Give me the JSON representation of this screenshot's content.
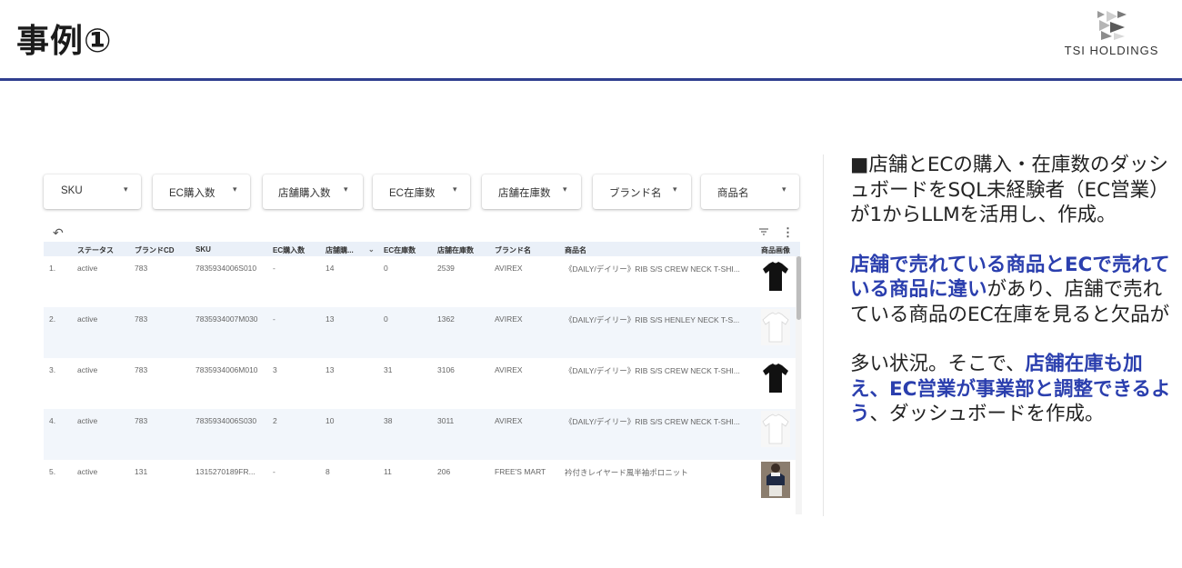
{
  "slide": {
    "title": "事例①",
    "logo_text": "TSI HOLDINGS"
  },
  "filters": [
    {
      "label": "SKU"
    },
    {
      "label": "EC購入数"
    },
    {
      "label": "店舗購入数"
    },
    {
      "label": "EC在庫数"
    },
    {
      "label": "店舗在庫数"
    },
    {
      "label": "ブランド名"
    },
    {
      "label": "商品名"
    }
  ],
  "table": {
    "headers": [
      "ステータス",
      "ブランドCD",
      "SKU",
      "EC購入数",
      "店舗購...",
      "EC在庫数",
      "店舗在庫数",
      "ブランド名",
      "商品名",
      "商品画像"
    ],
    "rows": [
      {
        "no": "1.",
        "status": "active",
        "brand_cd": "783",
        "sku": "7835934006S010",
        "ec_purchase": "-",
        "store_purchase": "14",
        "ec_stock": "0",
        "store_stock": "2539",
        "brand": "AVIREX",
        "product": "《DAILY/デイリー》RIB S/S CREW NECK T-SHI...",
        "image": "black-tshirt"
      },
      {
        "no": "2.",
        "status": "active",
        "brand_cd": "783",
        "sku": "7835934007M030",
        "ec_purchase": "-",
        "store_purchase": "13",
        "ec_stock": "0",
        "store_stock": "1362",
        "brand": "AVIREX",
        "product": "《DAILY/デイリー》RIB S/S HENLEY NECK T-S...",
        "image": "white-tshirt"
      },
      {
        "no": "3.",
        "status": "active",
        "brand_cd": "783",
        "sku": "7835934006M010",
        "ec_purchase": "3",
        "store_purchase": "13",
        "ec_stock": "31",
        "store_stock": "3106",
        "brand": "AVIREX",
        "product": "《DAILY/デイリー》RIB S/S CREW NECK T-SHI...",
        "image": "black-tshirt"
      },
      {
        "no": "4.",
        "status": "active",
        "brand_cd": "783",
        "sku": "7835934006S030",
        "ec_purchase": "2",
        "store_purchase": "10",
        "ec_stock": "38",
        "store_stock": "3011",
        "brand": "AVIREX",
        "product": "《DAILY/デイリー》RIB S/S CREW NECK T-SHI...",
        "image": "white-tshirt"
      },
      {
        "no": "5.",
        "status": "active",
        "brand_cd": "131",
        "sku": "1315270189FR...",
        "ec_purchase": "-",
        "store_purchase": "8",
        "ec_stock": "11",
        "store_stock": "206",
        "brand": "FREE'S MART",
        "product": "衿付きレイヤード風半袖ポロニット",
        "image": "model-photo"
      }
    ]
  },
  "side_text": {
    "p1": "■店舗とECの購入・在庫数のダッシュボードをSQL未経験者（EC営業）が1からLLMを活用し、作成。",
    "p2_hl": "店舗で売れている商品とECで売れている商品に違い",
    "p2_rest": "があり、店舗で売れている商品のEC在庫を見ると欠品が",
    "p3_a": "多い状況。そこで、",
    "p3_hl": "店舗在庫も加え、EC営業が事業部と調整できるよう",
    "p3_b": "、ダッシュボードを作成。"
  },
  "colors": {
    "accent_blue": "#2b3fae",
    "header_rule": "#2f3f8f",
    "table_header_bg": "#eaf0f8"
  }
}
